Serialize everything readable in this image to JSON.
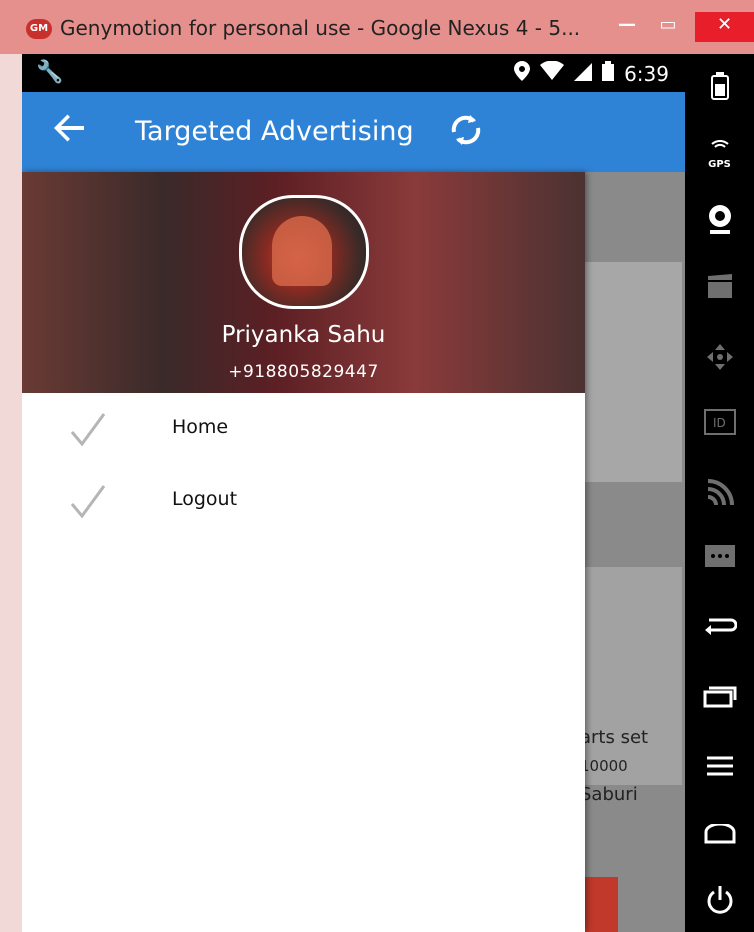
{
  "window": {
    "logo_text": "GM",
    "title": "Genymotion for personal use - Google Nexus 4 - 5...",
    "minimize": "—",
    "maximize": "▭",
    "close": "✕"
  },
  "statusbar": {
    "left_icon": "🔧",
    "time": "6:39"
  },
  "appbar": {
    "title": "Targeted Advertising"
  },
  "drawer": {
    "profile_name": "Priyanka Sahu",
    "profile_phone": "+918805829447",
    "menu": [
      {
        "label": "Home",
        "icon": "check-icon"
      },
      {
        "label": "Logout",
        "icon": "check-icon"
      }
    ]
  },
  "background": {
    "line1": "arts set",
    "line2": "10000",
    "line3": "Saburi"
  },
  "emulator_sidebar": {
    "icons": [
      "battery-icon",
      "gps-icon",
      "camera-icon",
      "clapper-icon",
      "move-icon",
      "id-icon",
      "rss-icon",
      "more-icon",
      "back-icon",
      "recent-apps-icon",
      "menu-icon",
      "home-icon",
      "power-icon"
    ]
  },
  "colors": {
    "appbar": "#2f83d6",
    "titlebar": "#e6908e",
    "close_button": "#e81e2a"
  }
}
